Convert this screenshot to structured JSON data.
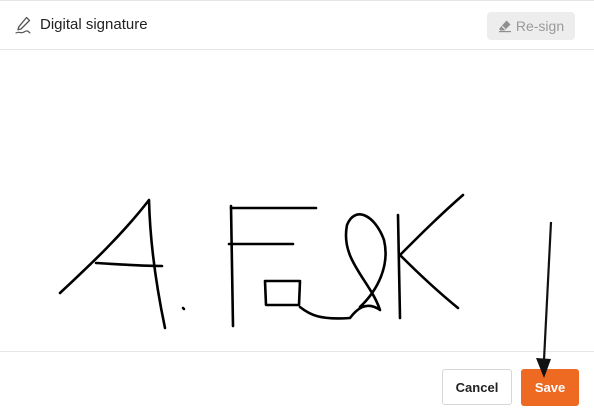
{
  "header": {
    "title": "Digital signature",
    "title_icon": "pen-icon",
    "resign_label": "Re-sign",
    "resign_icon": "eraser-icon"
  },
  "canvas": {
    "signature_text": "A. Falk",
    "stroke_color": "#000000"
  },
  "footer": {
    "cancel_label": "Cancel",
    "save_label": "Save"
  },
  "colors": {
    "accent": "#ee6a23",
    "disabled_button_bg": "#ededed",
    "disabled_button_text": "#9a9a9a"
  }
}
